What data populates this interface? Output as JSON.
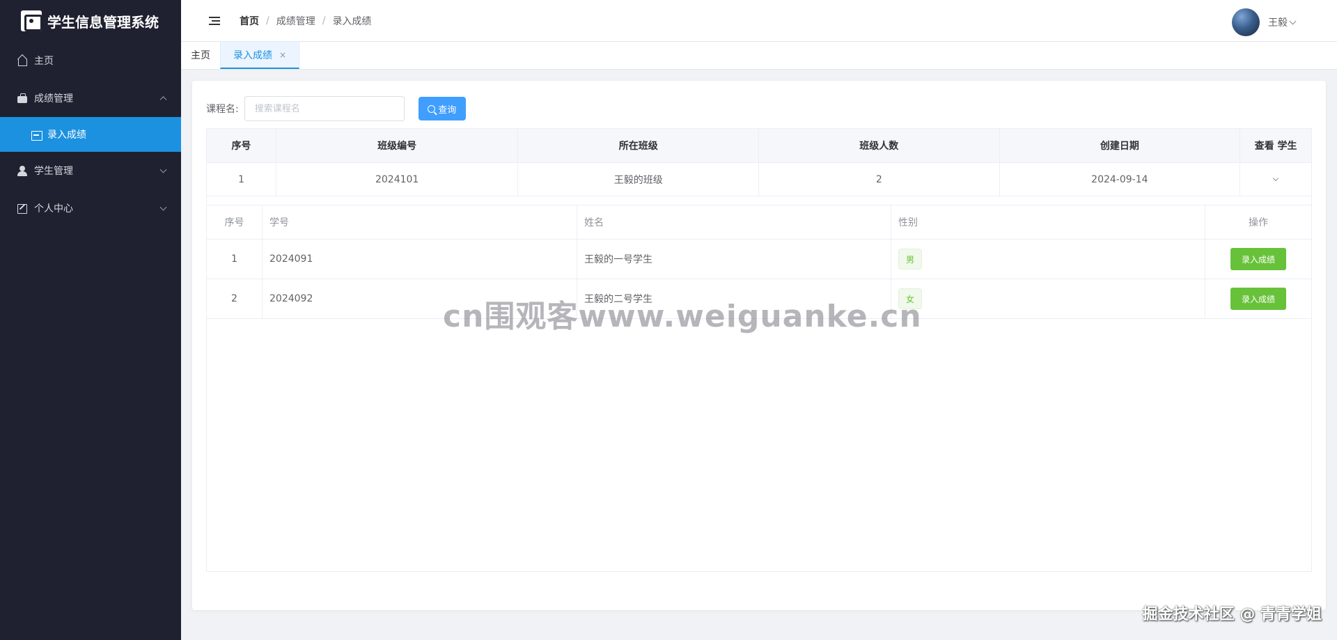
{
  "app": {
    "title": "学生信息管理系统"
  },
  "sidebar": {
    "items": [
      {
        "label": "主页"
      },
      {
        "label": "成绩管理",
        "children": [
          {
            "label": "录入成绩"
          }
        ]
      },
      {
        "label": "学生管理"
      },
      {
        "label": "个人中心"
      }
    ]
  },
  "header": {
    "breadcrumb": [
      "首页",
      "成绩管理",
      "录入成绩"
    ],
    "separator": "/",
    "user_name": "王毅"
  },
  "tabs": [
    {
      "label": "主页"
    },
    {
      "label": "录入成绩",
      "close": "×"
    }
  ],
  "search": {
    "label": "课程名:",
    "placeholder": "搜索课程名",
    "value": "",
    "button_label": "查询"
  },
  "class_table": {
    "headers": [
      "序号",
      "班级编号",
      "所在班级",
      "班级人数",
      "创建日期",
      "查看 学生"
    ],
    "rows": [
      {
        "index": "1",
        "class_no": "2024101",
        "class_name": "王毅的班级",
        "count": "2",
        "created": "2024-09-14"
      }
    ]
  },
  "student_table": {
    "headers": [
      "序号",
      "学号",
      "姓名",
      "性别",
      "操作"
    ],
    "rows": [
      {
        "index": "1",
        "student_no": "2024091",
        "name": "王毅的一号学生",
        "gender": "男",
        "action": "录入成绩"
      },
      {
        "index": "2",
        "student_no": "2024092",
        "name": "王毅的二号学生",
        "gender": "女",
        "action": "录入成绩"
      }
    ]
  },
  "watermarks": {
    "center": "cn围观客www.weiguanke.cn",
    "corner": "掘金技术社区 @ 青青学姐"
  },
  "colors": {
    "sidebar_bg": "#1f2130",
    "sidebar_active": "#1c91e0",
    "primary": "#409eff",
    "success": "#67c23a"
  }
}
